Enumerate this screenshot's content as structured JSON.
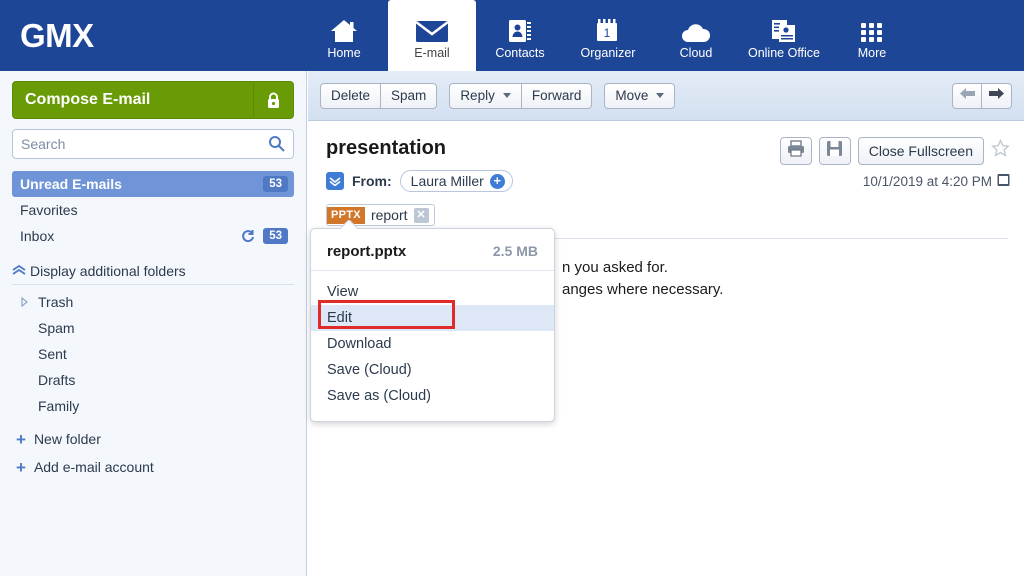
{
  "brand": {
    "logo": "GMX",
    "header_color": "#1d4697",
    "accent_green": "#699b06",
    "accent_blue": "#4f79c4",
    "attachment_badge_color": "#d2772a",
    "highlight_color": "#e02b2b"
  },
  "nav": [
    {
      "label": "Home",
      "icon": "home-icon",
      "active": false
    },
    {
      "label": "E-mail",
      "icon": "envelope-icon",
      "active": true
    },
    {
      "label": "Contacts",
      "icon": "contacts-icon",
      "active": false
    },
    {
      "label": "Organizer",
      "icon": "calendar-icon",
      "active": false,
      "calendar_day": "1"
    },
    {
      "label": "Cloud",
      "icon": "cloud-icon",
      "active": false
    },
    {
      "label": "Online Office",
      "icon": "documents-icon",
      "active": false
    },
    {
      "label": "More",
      "icon": "grid-dots-icon",
      "active": false
    }
  ],
  "sidebar": {
    "compose_label": "Compose E-mail",
    "compose_icon": "lock-icon",
    "search": {
      "value": "",
      "placeholder": "Search",
      "icon": "search-icon"
    },
    "folders": [
      {
        "label": "Unread E-mails",
        "badge": "53",
        "selected": true,
        "refresh": false
      },
      {
        "label": "Favorites",
        "badge": "",
        "selected": false,
        "refresh": false
      },
      {
        "label": "Inbox",
        "badge": "53",
        "selected": false,
        "refresh": true
      }
    ],
    "additional_label": "Display additional folders",
    "additional_icon": "chevron-up-icon",
    "extra_folders": [
      {
        "label": "Trash",
        "expandable": true
      },
      {
        "label": "Spam",
        "expandable": false
      },
      {
        "label": "Sent",
        "expandable": false
      },
      {
        "label": "Drafts",
        "expandable": false
      },
      {
        "label": "Family",
        "expandable": false
      }
    ],
    "new_folder_label": "New folder",
    "add_account_label": "Add e-mail account"
  },
  "toolbar": {
    "delete_label": "Delete",
    "spam_label": "Spam",
    "reply_label": "Reply",
    "forward_label": "Forward",
    "move_label": "Move",
    "prev_icon": "arrow-left-icon",
    "next_icon": "arrow-right-icon"
  },
  "message": {
    "subject": "presentation",
    "expand_icon": "double-chevron-down-icon",
    "from_label": "From:",
    "sender": "Laura Miller",
    "sender_add_icon": "add-contact-icon",
    "print_icon": "print-icon",
    "save_icon": "floppy-disk-icon",
    "close_fullscreen_label": "Close Fullscreen",
    "star_icon": "star-outline-icon",
    "timestamp": "10/1/2019 at 4:20 PM",
    "timestamp_icon": "calendar-small-icon",
    "attachment": {
      "type_badge": "PPTX",
      "name": "report",
      "remove_icon": "close-icon"
    },
    "body_line_1": "n you asked for.",
    "body_line_2": "anges where necessary."
  },
  "attachment_popup": {
    "file_name": "report.pptx",
    "file_size": "2.5 MB",
    "menu": [
      {
        "label": "View",
        "highlighted": false
      },
      {
        "label": "Edit",
        "highlighted": true
      },
      {
        "label": "Download",
        "highlighted": false
      },
      {
        "label": "Save (Cloud)",
        "highlighted": false
      },
      {
        "label": "Save as (Cloud)",
        "highlighted": false
      }
    ]
  }
}
